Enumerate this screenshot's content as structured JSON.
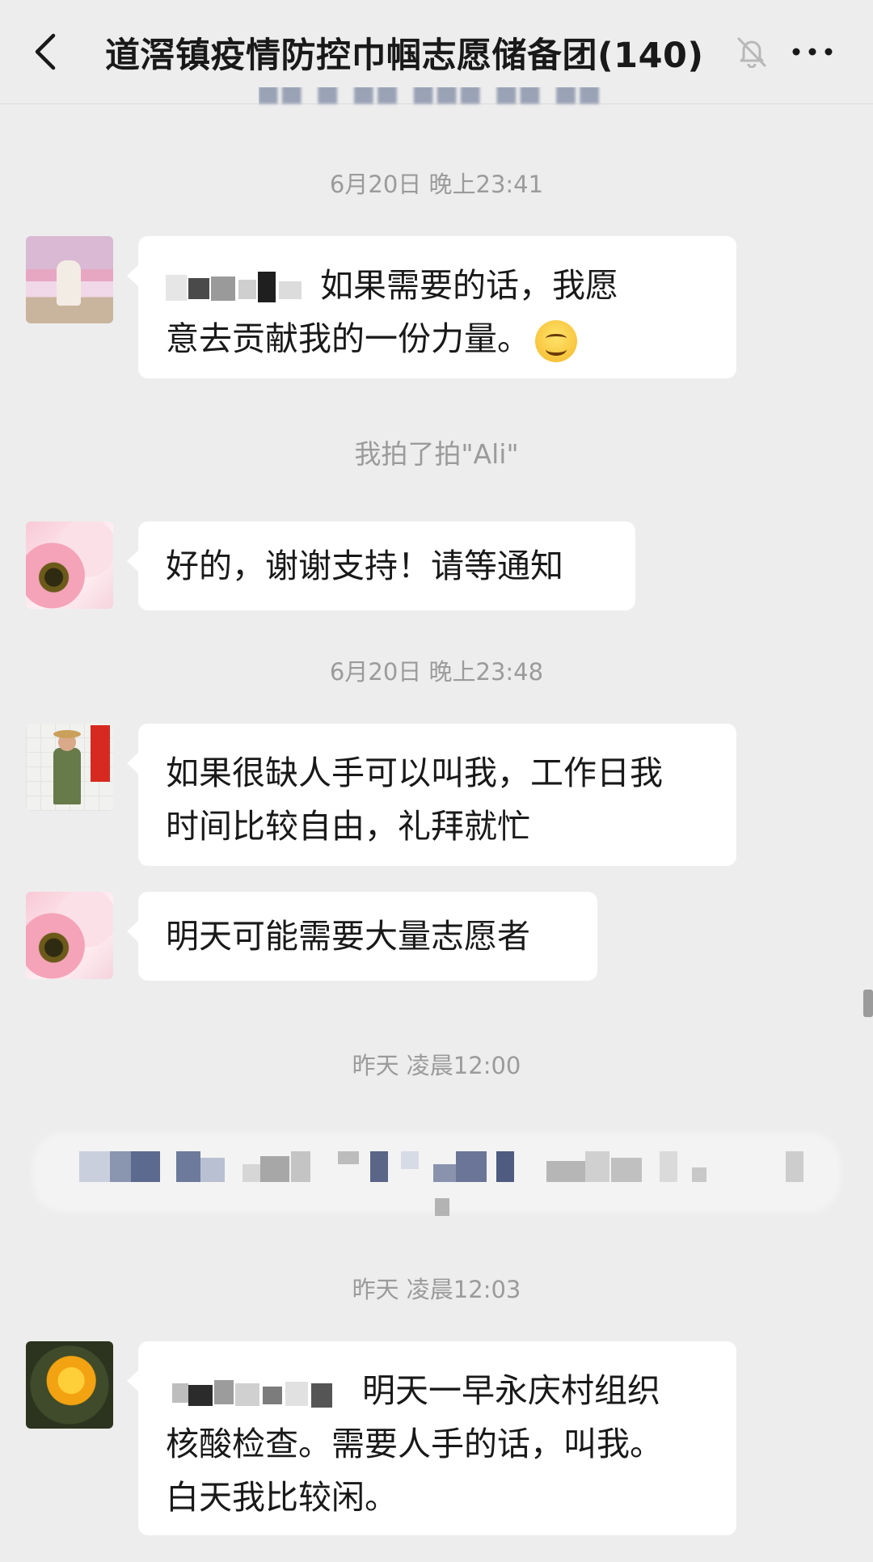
{
  "header": {
    "title": "道滘镇疫情防控巾帼志愿储备团(140)"
  },
  "messages": {
    "time1": "6月20日 晚上23:41",
    "m1_line1": "如果需要的话，我愿",
    "m1_line2": "意去贡献我的一份力量。",
    "pat": "我拍了拍\"Ali\"",
    "m2": "好的，谢谢支持！请等通知",
    "time2": "6月20日 晚上23:48",
    "m3_line1": "如果很缺人手可以叫我，工作日我",
    "m3_line2": "时间比较自由，礼拜就忙",
    "m4": "明天可能需要大量志愿者",
    "time3": "昨天 凌晨12:00",
    "time4": "昨天 凌晨12:03",
    "m5_line1": "明天一早永庆村组织",
    "m5_line2": "核酸检查。需要人手的话，叫我。",
    "m5_line3": "白天我比较闲。"
  },
  "icons": {
    "back": "chevron-left-icon",
    "mute": "bell-muted-icon",
    "more": "more-dots-icon",
    "emoji": "smiling-face-emoji"
  },
  "colors": {
    "background": "#ededed",
    "bubble": "#ffffff",
    "timestamp": "#9b9b9b"
  }
}
